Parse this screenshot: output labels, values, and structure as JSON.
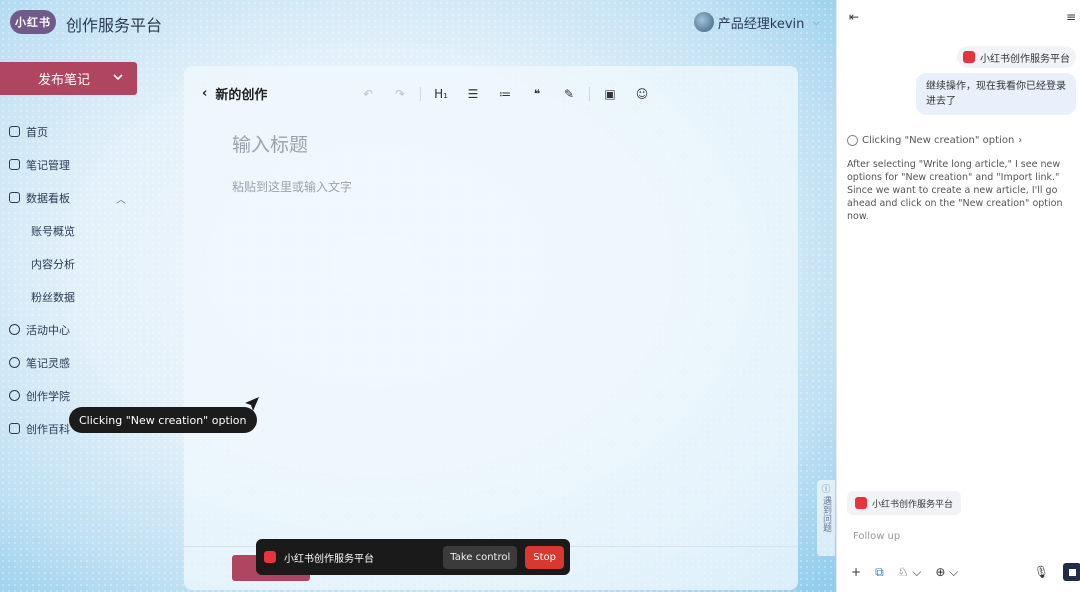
{
  "app": {
    "logo_text": "小红书",
    "brand": "创作服务平台",
    "user_name": "产品经理kevin",
    "publish_label": "发布笔记"
  },
  "nav": {
    "items": [
      {
        "label": "首页"
      },
      {
        "label": "笔记管理"
      },
      {
        "label": "数据看板"
      },
      {
        "label": "账号概览"
      },
      {
        "label": "内容分析"
      },
      {
        "label": "粉丝数据"
      },
      {
        "label": "活动中心"
      },
      {
        "label": "笔记灵感"
      },
      {
        "label": "创作学院"
      },
      {
        "label": "创作百科"
      }
    ]
  },
  "editor": {
    "header": "新的创作",
    "title_placeholder": "输入标题",
    "body_placeholder": "粘贴到这里或输入文字"
  },
  "tooltip": "Clicking \"New creation\" option",
  "controlbar": {
    "title": "小红书创作服务平台",
    "take_control": "Take control",
    "stop": "Stop"
  },
  "feedback": {
    "label": "遇到问题"
  },
  "panel": {
    "site_chip": "小红书创作服务平台",
    "user_message": "继续操作，现在我看你已经登录进去了",
    "step_label": "Clicking \"New creation\" option",
    "reasoning": "After selecting \"Write long article,\" I see new options for \"New creation\" and \"Import link.\" Since we want to create a new article, I'll go ahead and click on the \"New creation\" option now.",
    "context_chip": "小红书创作服务平台",
    "followup_placeholder": "Follow up"
  },
  "colors": {
    "accent": "#b0455f",
    "stop": "#d9382e",
    "panel_bubble": "#e9f0fb"
  }
}
